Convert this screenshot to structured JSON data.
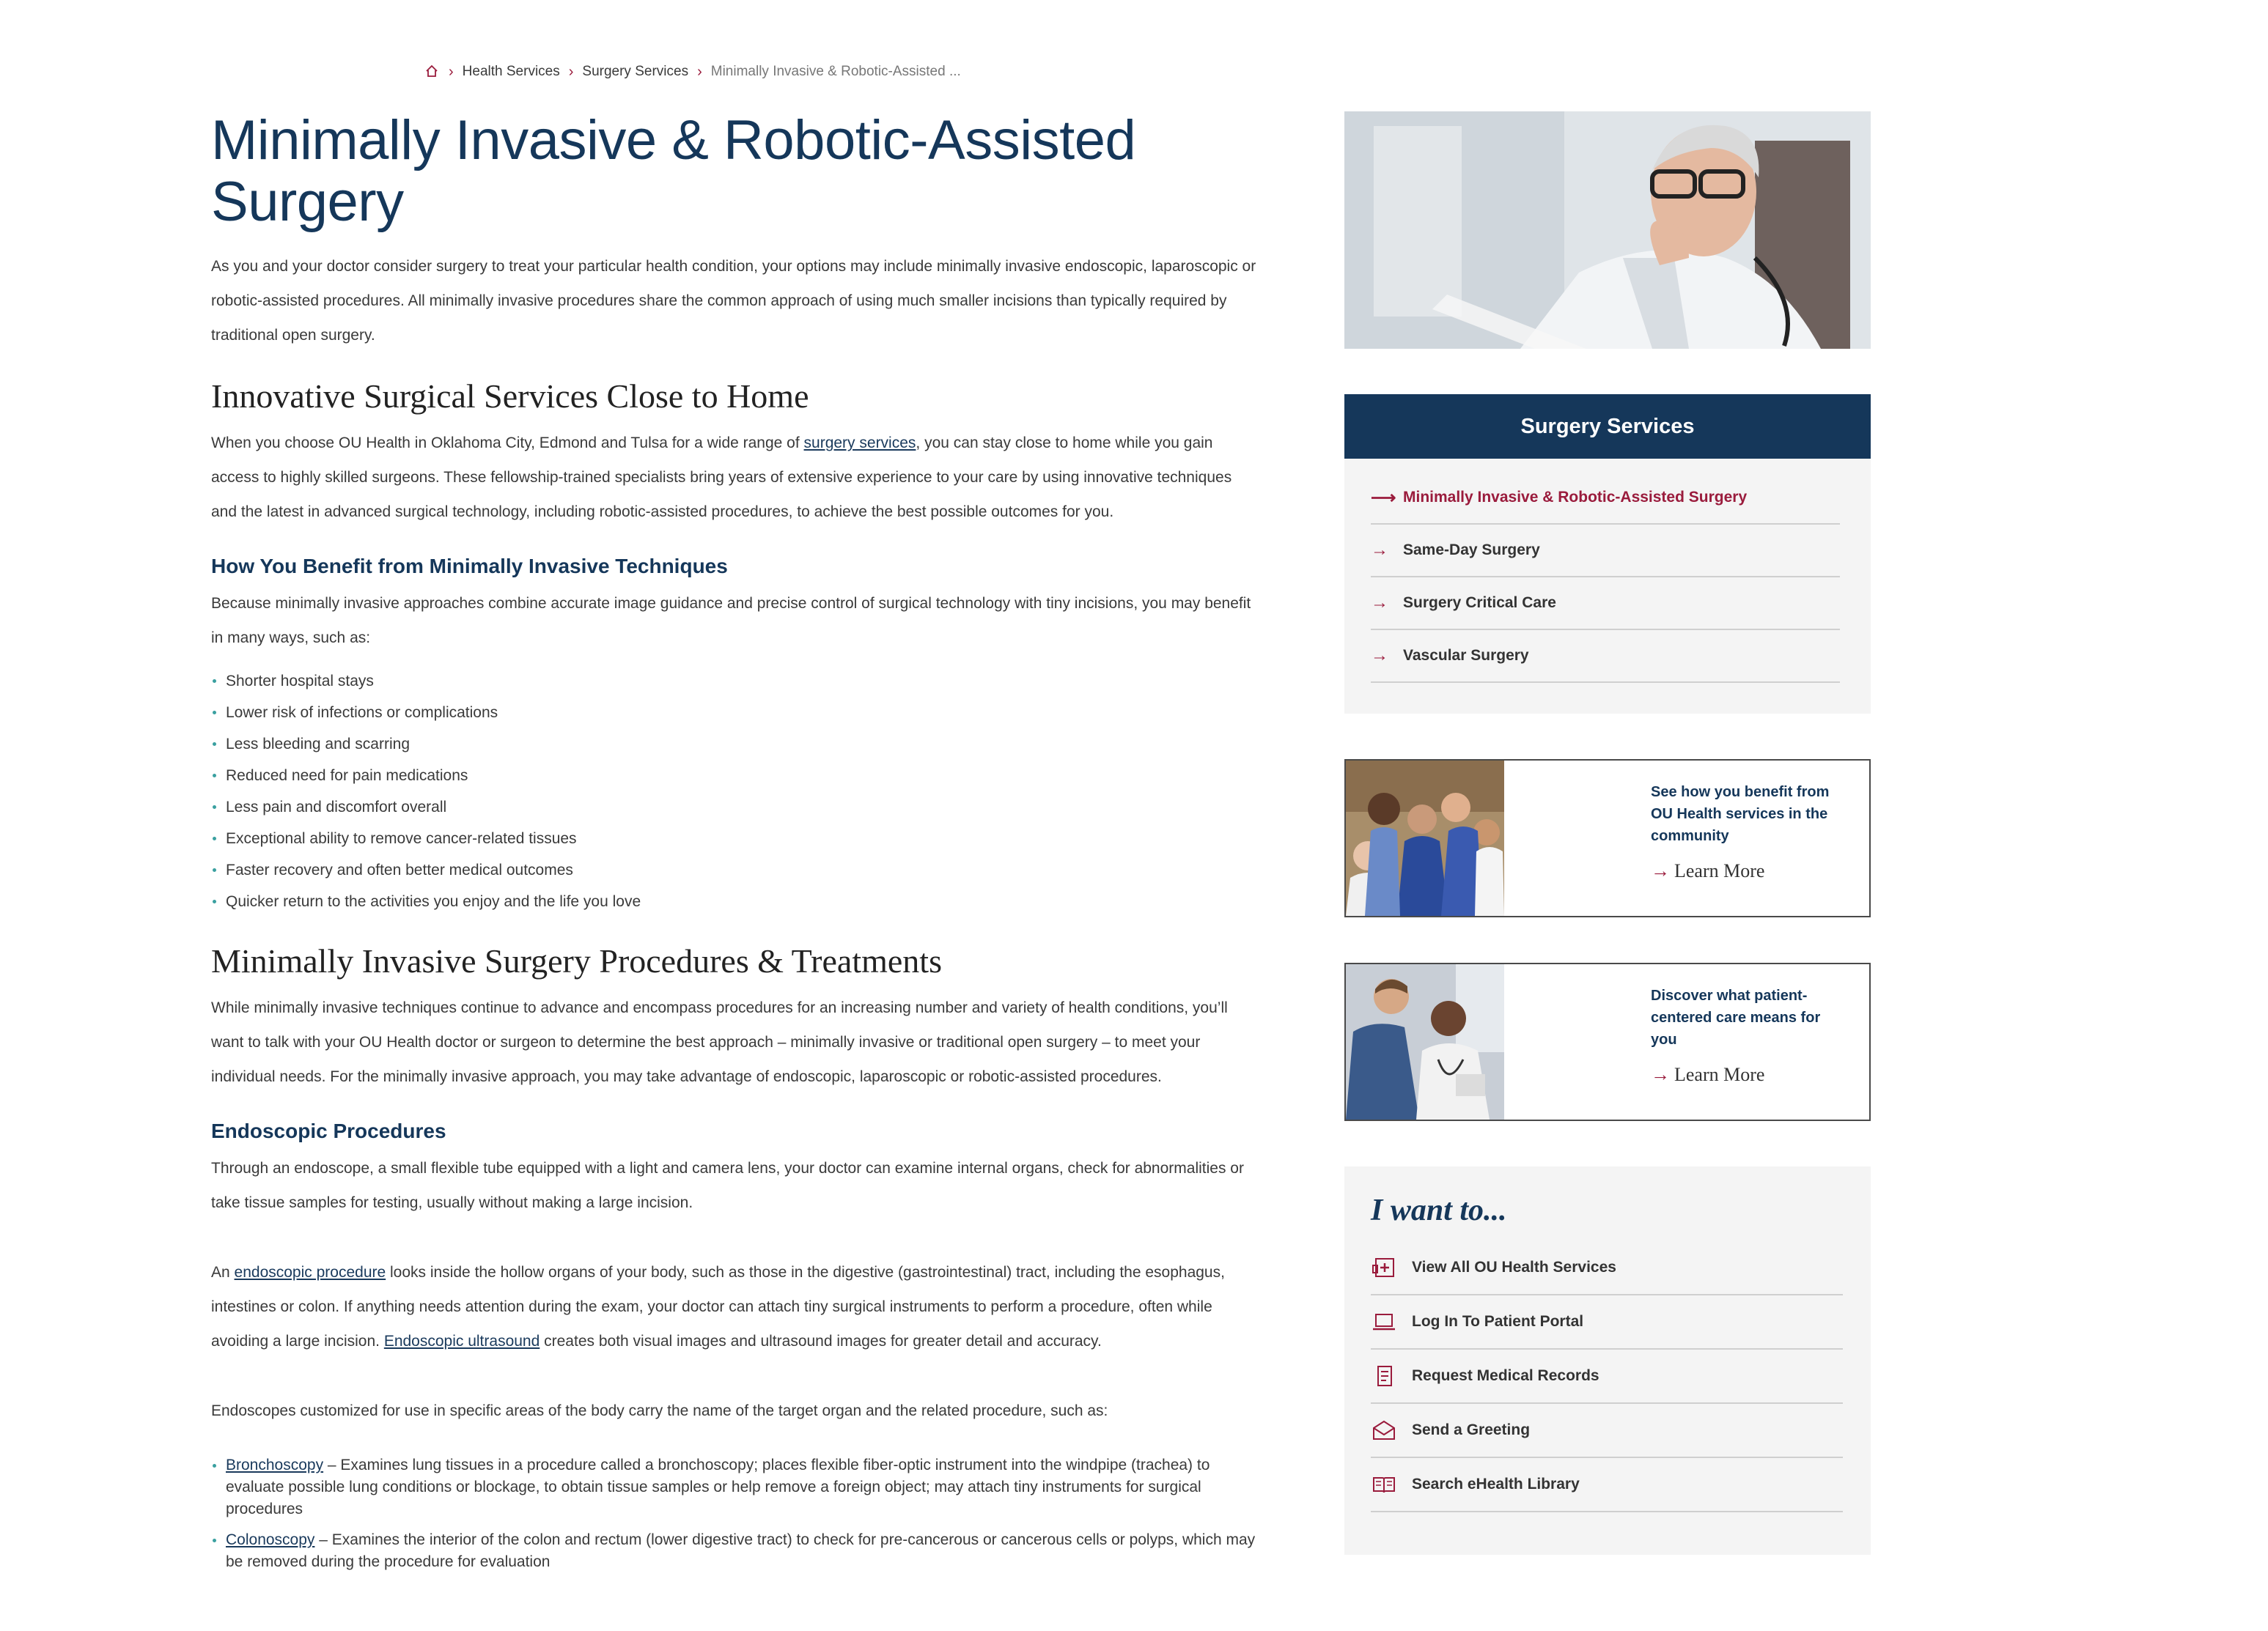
{
  "breadcrumb": {
    "items": [
      "Health Services",
      "Surgery Services"
    ],
    "current": "Minimally Invasive & Robotic-Assisted ..."
  },
  "page": {
    "title": "Minimally Invasive & Robotic-Assisted Surgery",
    "intro": "As you and your doctor consider surgery to treat your particular health condition, your options may include minimally invasive endoscopic, laparoscopic or robotic-assisted procedures. All minimally invasive procedures share the common approach of using much smaller incisions than typically required by traditional open surgery."
  },
  "section1": {
    "heading": "Innovative Surgical Services Close to Home",
    "text_before_link": "When you choose OU Health in Oklahoma City, Edmond and Tulsa for a wide range of ",
    "link": "surgery services",
    "text_after_link": ", you can stay close to home while you gain access to highly skilled surgeons. These fellowship-trained specialists bring years of extensive experience to your care by using innovative techniques and the latest in advanced surgical technology, including robotic-assisted procedures, to achieve the best possible outcomes for you."
  },
  "section2": {
    "heading": "How You Benefit from Minimally Invasive Techniques",
    "text": "Because minimally invasive approaches combine accurate image guidance and precise control of surgical technology with tiny incisions, you may benefit in many ways, such as:",
    "bullets": [
      "Shorter hospital stays",
      "Lower risk of infections or complications",
      "Less bleeding and scarring",
      "Reduced need for pain medications",
      "Less pain and discomfort overall",
      "Exceptional ability to remove cancer-related tissues",
      "Faster recovery and often better medical outcomes",
      "Quicker return to the activities you enjoy and the life you love"
    ]
  },
  "section3": {
    "heading": "Minimally Invasive Surgery Procedures & Treatments",
    "text": "While minimally invasive techniques continue to advance and encompass procedures for an increasing number and variety of health conditions, you’ll want to talk with your OU Health doctor or surgeon to determine the best approach – minimally invasive or traditional open surgery – to meet your individual needs. For the minimally invasive approach, you may take advantage of endoscopic, laparoscopic or robotic-assisted procedures."
  },
  "section4": {
    "heading": "Endoscopic Procedures",
    "text1": "Through an endoscope, a small flexible tube equipped with a light and camera lens, your doctor can examine internal organs, check for abnormalities or take tissue samples for testing, usually without making a large incision.",
    "p2_a": "An ",
    "p2_link1": "endoscopic procedure",
    "p2_b": " looks inside the hollow organs of your body, such as those in the digestive (gastrointestinal) tract, including the esophagus, intestines or colon. If anything needs attention during the exam, your doctor can attach tiny surgical instruments to perform a procedure, often while avoiding a large incision. ",
    "p2_link2": "Endoscopic ultrasound",
    "p2_c": " creates both visual images and ultrasound images for greater detail and accuracy.",
    "text3": "Endoscopes customized for use in specific areas of the body carry the name of the target organ and the related procedure, such as:",
    "defs": [
      {
        "term": "Bronchoscopy",
        "desc": " – Examines lung tissues in a procedure called a bronchoscopy; places flexible fiber-optic instrument into the windpipe (trachea) to evaluate possible lung conditions or blockage, to obtain tissue samples or help remove a foreign object; may attach tiny instruments for surgical procedures"
      },
      {
        "term": "Colonoscopy",
        "desc": " – Examines the interior of the colon and rectum (lower digestive tract) to check for pre-cancerous or cancerous cells or polyps, which may be removed during the procedure for evaluation"
      }
    ]
  },
  "sidebar": {
    "services": {
      "title": "Surgery Services",
      "items": [
        "Minimally Invasive & Robotic-Assisted Surgery",
        "Same-Day Surgery",
        "Surgery Critical Care",
        "Vascular Surgery"
      ]
    },
    "promos": [
      {
        "title": "See how you benefit from OU Health services in the community",
        "link": "Learn More"
      },
      {
        "title": "Discover what patient-centered care means for you",
        "link": "Learn More"
      }
    ],
    "iwant": {
      "title": "I want to...",
      "items": [
        {
          "label": "View All OU Health Services",
          "icon": "hospital-icon"
        },
        {
          "label": "Log In To Patient Portal",
          "icon": "laptop-icon"
        },
        {
          "label": "Request Medical Records",
          "icon": "records-icon"
        },
        {
          "label": "Send a Greeting",
          "icon": "envelope-icon"
        },
        {
          "label": "Search eHealth Library",
          "icon": "book-icon"
        }
      ]
    }
  },
  "colors": {
    "navy": "#15375a",
    "crimson": "#9a1b3c",
    "panel": "#f4f4f4"
  }
}
